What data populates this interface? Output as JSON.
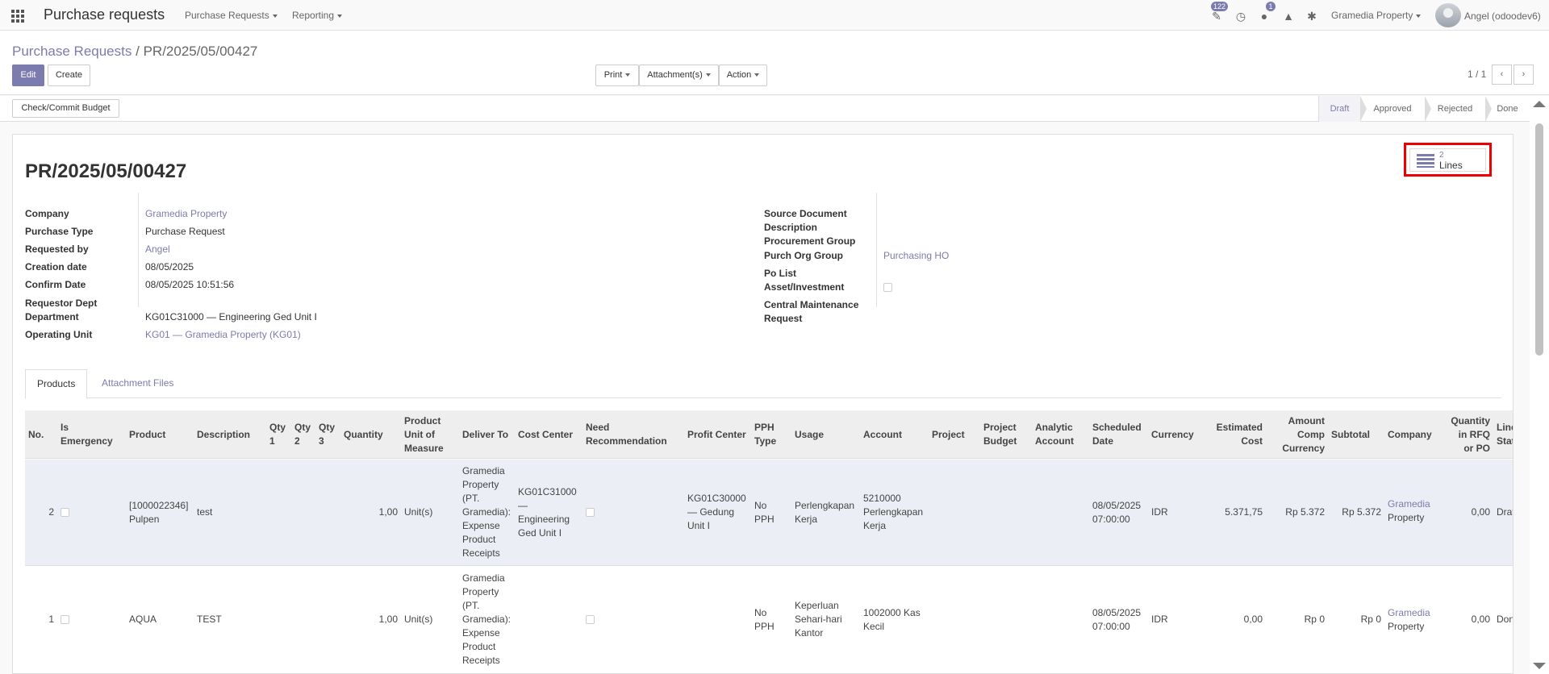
{
  "app": {
    "title": "Purchase requests"
  },
  "nav": {
    "menus": [
      "Purchase Requests",
      "Reporting"
    ],
    "badges": {
      "activity": "122",
      "messages": "1"
    },
    "company": "Gramedia Property",
    "user": "Angel (odoodev6)"
  },
  "breadcrumb": {
    "parent": "Purchase Requests",
    "separator": "/",
    "current": "PR/2025/05/00427"
  },
  "toolbar": {
    "edit": "Edit",
    "create": "Create",
    "print": "Print",
    "attachments": "Attachment(s)",
    "action": "Action"
  },
  "pager": {
    "value": "1 / 1",
    "prev": "‹",
    "next": "›"
  },
  "statusbar": {
    "budget_button": "Check/Commit Budget",
    "states": [
      "Draft",
      "Approved",
      "Rejected",
      "Done"
    ],
    "active": "Draft"
  },
  "record": {
    "title": "PR/2025/05/00427",
    "smart_button": {
      "count": "2",
      "label": "Lines"
    },
    "left_fields": [
      {
        "label": "Company",
        "value": "Gramedia Property",
        "link": true
      },
      {
        "label": "Purchase Type",
        "value": "Purchase Request",
        "link": false
      },
      {
        "label": "Requested by",
        "value": "Angel",
        "link": true
      },
      {
        "label": "Creation date",
        "value": "08/05/2025",
        "link": false
      },
      {
        "label": "Confirm Date",
        "value": "08/05/2025 10:51:56",
        "link": false
      },
      {
        "label": "Requestor Dept",
        "value": "",
        "link": false
      },
      {
        "label": "Department",
        "value": "KG01C31000 — Engineering Ged Unit I",
        "link": false
      },
      {
        "label": "Operating Unit",
        "value": "KG01 — Gramedia Property (KG01)",
        "link": true
      }
    ],
    "right_fields": [
      {
        "label": "Source Document",
        "value": ""
      },
      {
        "label": "Description",
        "value": ""
      },
      {
        "label": "Procurement Group",
        "value": ""
      },
      {
        "label": "Purch Org Group",
        "value": "Purchasing HO"
      },
      {
        "label": "Po List",
        "value": ""
      },
      {
        "label": "Asset/Investment",
        "value": ""
      },
      {
        "label": "Central Maintenance Request",
        "value": ""
      }
    ]
  },
  "tabs": [
    "Products",
    "Attachment Files"
  ],
  "table": {
    "headers": [
      "No.",
      "Is Emergency",
      "Product",
      "Description",
      "Qty 1",
      "Qty 2",
      "Qty 3",
      "Quantity",
      "Product Unit of Measure",
      "Deliver To",
      "Cost Center",
      "Need Recommendation",
      "Profit Center",
      "PPH Type",
      "Usage",
      "Account",
      "Project",
      "Project Budget",
      "Analytic Account",
      "Scheduled Date",
      "Currency",
      "Estimated Cost",
      "Amount Comp Currency",
      "Subtotal",
      "Company",
      "Quantity in RFQ or PO",
      "Line State"
    ],
    "rows": [
      {
        "no": "2",
        "product": "[1000022346] Pulpen",
        "description": "test",
        "quantity": "1,00",
        "uom": "Unit(s)",
        "deliver_to": "Gramedia Property (PT. Gramedia): Expense Product Receipts",
        "cost_center": "KG01C31000 — Engineering Ged Unit I",
        "profit_center": "KG01C30000 — Gedung Unit I",
        "pph": "No PPH",
        "usage": "Perlengkapan Kerja",
        "account": "5210000 Perlengkapan Kerja",
        "scheduled": "08/05/2025 07:00:00",
        "currency": "IDR",
        "est_cost": "5.371,75",
        "amount_comp": "Rp 5.372",
        "subtotal": "Rp 5.372",
        "company_a": "Gramedia",
        "company_b": "Property",
        "qty_rfq": "0,00",
        "state": "Draft"
      },
      {
        "no": "1",
        "product": "AQUA",
        "description": "TEST",
        "quantity": "1,00",
        "uom": "Unit(s)",
        "deliver_to": "Gramedia Property (PT. Gramedia): Expense Product Receipts",
        "cost_center": "",
        "profit_center": "",
        "pph": "No PPH",
        "usage": "Keperluan Sehari-hari Kantor",
        "account": "1002000 Kas Kecil",
        "scheduled": "08/05/2025 07:00:00",
        "currency": "IDR",
        "est_cost": "0,00",
        "amount_comp": "Rp 0",
        "subtotal": "Rp 0",
        "company_a": "Gramedia",
        "company_b": "Property",
        "qty_rfq": "0,00",
        "state": "Done"
      }
    ]
  },
  "colors": {
    "accent": "#7c7bad",
    "highlight_border": "#e00000"
  }
}
